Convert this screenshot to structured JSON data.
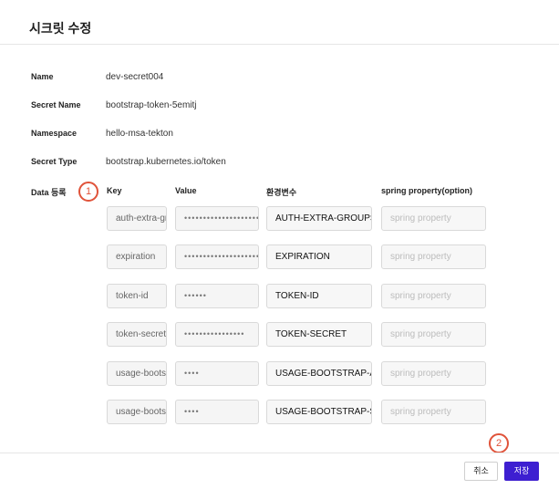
{
  "dialog": {
    "title": "시크릿 수정"
  },
  "info": [
    {
      "label": "Name",
      "value": "dev-secret004"
    },
    {
      "label": "Secret Name",
      "value": "bootstrap-token-5emitj"
    },
    {
      "label": "Namespace",
      "value": "hello-msa-tekton"
    },
    {
      "label": "Secret Type",
      "value": "bootstrap.kubernetes.io/token"
    }
  ],
  "data_section": {
    "label": "Data 등록",
    "columns": {
      "key": "Key",
      "value": "Value",
      "env": "환경변수",
      "spring": "spring property(option)"
    },
    "spring_placeholder": "spring property",
    "rows": [
      {
        "key": "auth-extra-groups",
        "value": "••••••••••••••••••••",
        "env": "AUTH-EXTRA-GROUPS"
      },
      {
        "key": "expiration",
        "value": "••••••••••••••••••••",
        "env": "EXPIRATION"
      },
      {
        "key": "token-id",
        "value": "••••••",
        "env": "TOKEN-ID"
      },
      {
        "key": "token-secret",
        "value": "••••••••••••••••",
        "env": "TOKEN-SECRET"
      },
      {
        "key": "usage-bootstrap-authentication",
        "value": "••••",
        "env": "USAGE-BOOTSTRAP-AUTHENTICATION"
      },
      {
        "key": "usage-bootstrap-signing",
        "value": "••••",
        "env": "USAGE-BOOTSTRAP-SIGNING"
      }
    ]
  },
  "annotations": {
    "step1": "1",
    "step2": "2"
  },
  "footer": {
    "cancel_label": "취소",
    "save_label": "저장"
  },
  "colors": {
    "accent": "#3d1fd1",
    "annotation": "#e0533a"
  }
}
